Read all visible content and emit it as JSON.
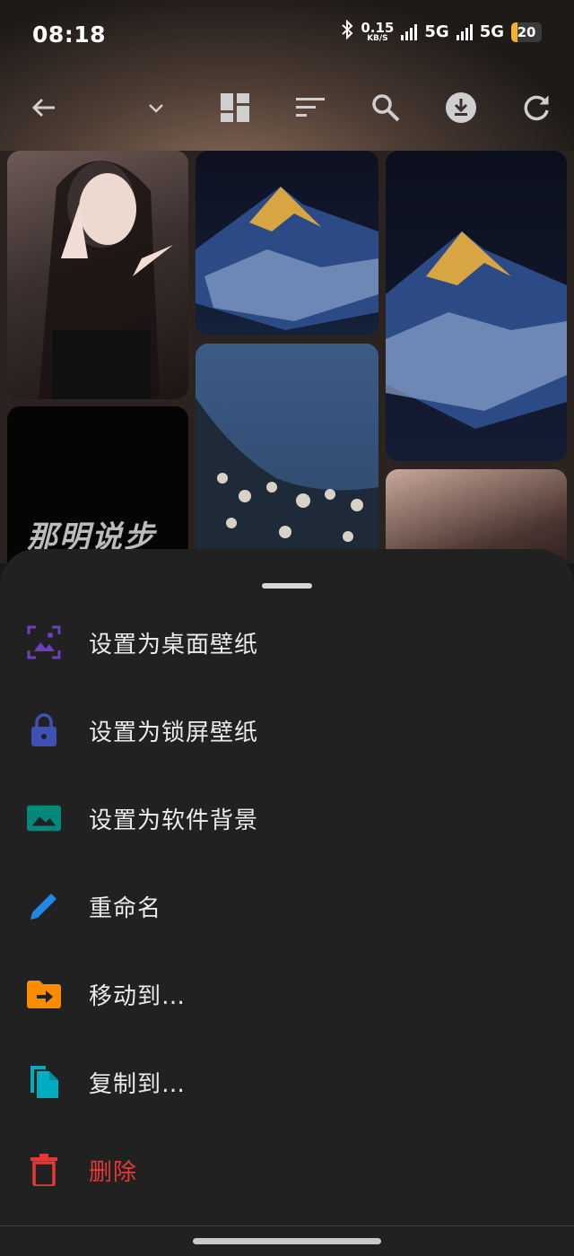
{
  "status_bar": {
    "time": "08:18",
    "net_speed_value": "0.15",
    "net_speed_unit": "KB/S",
    "network1": "5G",
    "network2": "5G",
    "battery": "20",
    "battery_level_percent": 20
  },
  "toolbar": {
    "icons": [
      "back-arrow-icon",
      "dropdown-chevron-icon",
      "dashboard-layout-icon",
      "sort-icon",
      "search-icon",
      "download-icon",
      "refresh-icon"
    ]
  },
  "gallery": {
    "tile_overlay_text": "那明说步"
  },
  "menu": {
    "items": [
      {
        "label": "设置为桌面壁纸",
        "icon": "wallpaper-icon",
        "color": "#5e35b1"
      },
      {
        "label": "设置为锁屏壁纸",
        "icon": "lock-icon",
        "color": "#3f51b5"
      },
      {
        "label": "设置为软件背景",
        "icon": "image-icon",
        "color": "#00897b"
      },
      {
        "label": "重命名",
        "icon": "pencil-icon",
        "color": "#1e88e5"
      },
      {
        "label": "移动到…",
        "icon": "folder-move-icon",
        "color": "#fb8c00"
      },
      {
        "label": "复制到…",
        "icon": "copy-icon",
        "color": "#00acc1"
      },
      {
        "label": "删除",
        "icon": "trash-icon",
        "color": "#e53935"
      }
    ]
  }
}
